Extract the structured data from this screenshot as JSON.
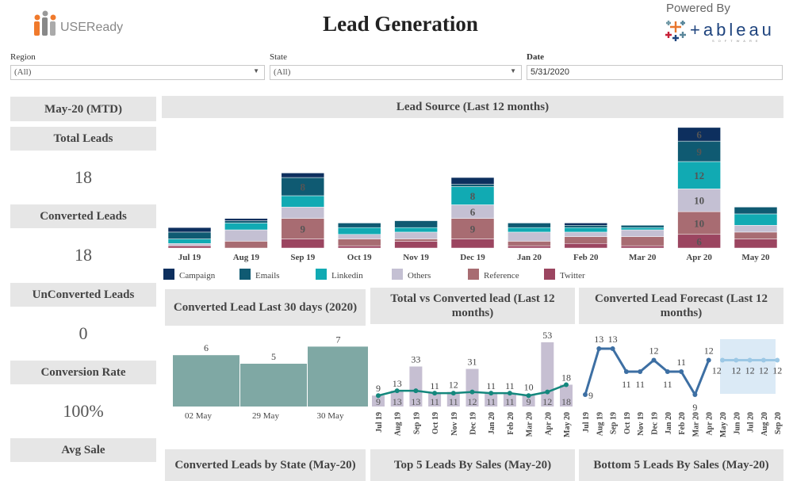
{
  "header": {
    "logo_text": "USEReady",
    "title": "Lead Generation",
    "powered_by": "Powered By",
    "tableau_logo": "+ableau",
    "tableau_sub": "SOFTWARE"
  },
  "filters": [
    {
      "label": "Region",
      "value": "(All)"
    },
    {
      "label": "State",
      "value": "(All)"
    },
    {
      "label": "Date",
      "value": "5/31/2020"
    }
  ],
  "kpis": {
    "period": "May-20 (MTD)",
    "items": [
      {
        "label": "Total Leads",
        "value": "18"
      },
      {
        "label": "Converted Leads",
        "value": "18"
      },
      {
        "label": "UnConverted Leads",
        "value": "0"
      },
      {
        "label": "Conversion Rate",
        "value": "100%"
      },
      {
        "label": "Avg Sale",
        "value": ""
      }
    ]
  },
  "panels": {
    "lead_source": "Lead Source (Last 12 months)",
    "last30": "Converted Lead Last 30 days (2020)",
    "total_vs": "Total vs Converted lead (Last 12 months)",
    "forecast": "Converted Lead Forecast (Last 12 months)",
    "by_state": "Converted Leads by State (May-20)",
    "top5": "Top 5 Leads By Sales (May-20)",
    "bottom5": "Bottom 5 Leads By Sales (May-20)"
  },
  "colors": {
    "Campaign": "#0d2f5e",
    "Emails": "#0f5a72",
    "Linkedin": "#11aab3",
    "Others": "#c4c0d3",
    "Reference": "#a86c72",
    "Twitter": "#9b4560",
    "teal_bar": "#7fa8a4",
    "lavender_bar": "#c6bfd2",
    "teal_line": "#14877d",
    "forecast_line": "#3d6fa3",
    "forecast_light": "#9cc8e5",
    "forecast_band": "#dbeaf6"
  },
  "chart_data": [
    {
      "type": "bar",
      "stacked": true,
      "title": "Lead Source (Last 12 months)",
      "categories": [
        "Jul 19",
        "Aug 19",
        "Sep 19",
        "Oct 19",
        "Nov 19",
        "Dec 19",
        "Jan 20",
        "Feb 20",
        "Mar 20",
        "Apr 20",
        "May 20"
      ],
      "series": [
        {
          "name": "Twitter",
          "values": [
            1,
            0,
            4,
            1,
            3,
            4,
            1,
            2,
            1,
            6,
            4
          ]
        },
        {
          "name": "Reference",
          "values": [
            0,
            3,
            9,
            3,
            1,
            9,
            2,
            3,
            4,
            10,
            3
          ]
        },
        {
          "name": "Others",
          "values": [
            1,
            5,
            5,
            2,
            3,
            6,
            4,
            2,
            3,
            10,
            3
          ]
        },
        {
          "name": "Linkedin",
          "values": [
            2,
            3,
            5,
            3,
            2,
            8,
            2,
            2,
            1,
            12,
            5
          ]
        },
        {
          "name": "Emails",
          "values": [
            3,
            1,
            8,
            2,
            3,
            1,
            2,
            1,
            1,
            9,
            3
          ]
        },
        {
          "name": "Campaign",
          "values": [
            2,
            1,
            2,
            0,
            0,
            3,
            0,
            1,
            0,
            6,
            0
          ]
        }
      ],
      "shown_labels": {
        "Sep 19": {
          "Emails": 8,
          "Reference": 9
        },
        "Dec 19": {
          "Linkedin": 8,
          "Others": 6,
          "Reference": 9
        },
        "Apr 20": {
          "Campaign": 6,
          "Emails": 9,
          "Linkedin": 12,
          "Others": 10,
          "Reference": 10,
          "Twitter": 6
        }
      },
      "legend": "bottom"
    },
    {
      "type": "bar",
      "title": "Converted Lead Last 30 days (2020)",
      "categories": [
        "02 May",
        "29 May",
        "30 May"
      ],
      "values": [
        6,
        5,
        7
      ]
    },
    {
      "type": "bar+line",
      "title": "Total vs Converted lead (Last 12 months)",
      "categories": [
        "Jul 19",
        "Aug 19",
        "Sep 19",
        "Oct 19",
        "Nov 19",
        "Dec 19",
        "Jan 20",
        "Feb 20",
        "Mar 20",
        "Apr 20",
        "May 20"
      ],
      "series": [
        {
          "values": [
            9,
            13,
            33,
            11,
            12,
            31,
            11,
            11,
            10,
            53,
            18
          ]
        },
        {
          "values": [
            9,
            13,
            13,
            11,
            11,
            12,
            11,
            11,
            9,
            12,
            18
          ]
        }
      ]
    },
    {
      "type": "line",
      "title": "Converted Lead Forecast (Last 12 months)",
      "categories": [
        "Jul 19",
        "Aug 19",
        "Sep 19",
        "Oct 19",
        "Nov 19",
        "Dec 19",
        "Jan 20",
        "Feb 20",
        "Mar 20",
        "Apr 20",
        "May 20",
        "Jun 20",
        "Jul 20",
        "Aug 20",
        "Sep 20"
      ],
      "actual": [
        9,
        13,
        13,
        11,
        11,
        12,
        11,
        11,
        9,
        12
      ],
      "forecast": [
        12,
        12,
        12,
        12,
        12
      ]
    }
  ]
}
